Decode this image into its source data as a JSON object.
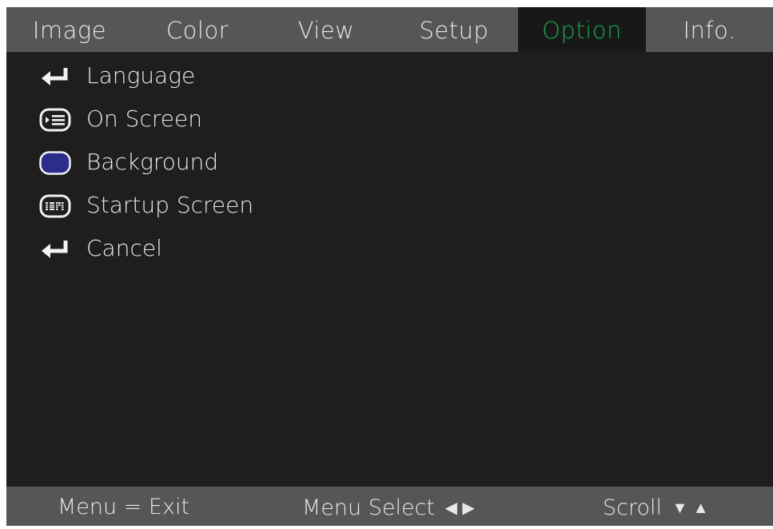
{
  "tabs": [
    "Image",
    "Color",
    "View",
    "Setup",
    "Option",
    "Info."
  ],
  "active_tab": "Option",
  "menu": {
    "items": [
      {
        "label": "Language",
        "icon": "enter-arrow-icon"
      },
      {
        "label": "On Screen",
        "icon": "on-screen-display-icon"
      },
      {
        "label": "Background",
        "icon": "blue-background-icon"
      },
      {
        "label": "Startup Screen",
        "icon": "ibm-logo-icon"
      },
      {
        "label": "Cancel",
        "icon": "enter-arrow-icon"
      }
    ]
  },
  "footer": {
    "menu_exit": "Menu = Exit",
    "menu_select": "Menu Select",
    "menu_select_arrows": "◀ ▶",
    "scroll": "Scroll",
    "scroll_arrows": "▼ ▲"
  },
  "colors": {
    "bar": "#565656",
    "panel": "#201d1d",
    "active_tab_text": "#19a84a",
    "background_swatch": "#2b2d8c"
  }
}
